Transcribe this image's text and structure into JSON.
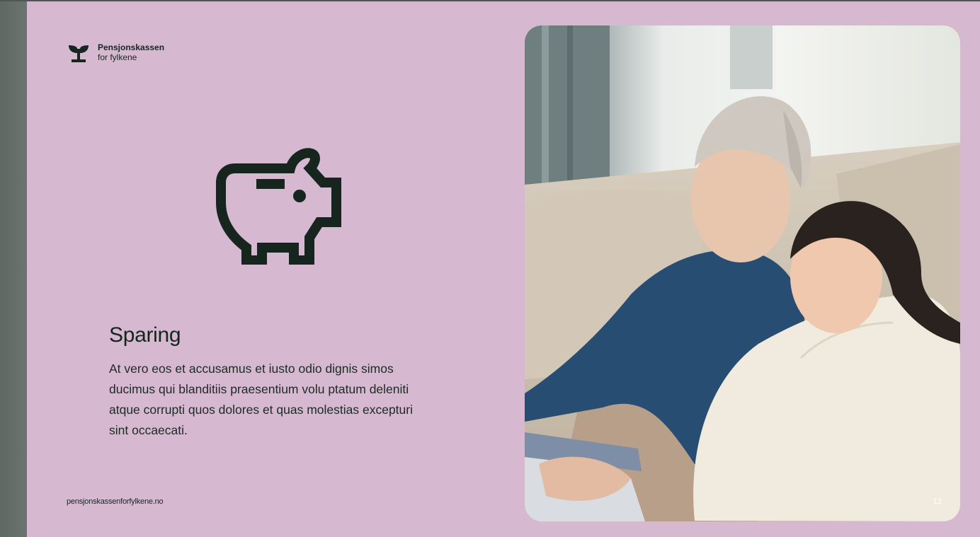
{
  "brand": {
    "name": "Pensjonskassen",
    "sub": "for fylkene",
    "logo_icon": "sprout-icon"
  },
  "icon": "piggy-bank-icon",
  "section": {
    "title": "Sparing",
    "body": "At vero eos et accusamus et iusto odio dignis simos ducimus qui blanditiis praesentium volu ptatum deleniti atque corrupti quos dolores et quas molestias excepturi sint occaecati."
  },
  "footer": {
    "url": "pensjonskassenforfylkene.no"
  },
  "page": {
    "number": "12"
  },
  "photo": {
    "subject": "two-women-laughing-photo"
  },
  "colors": {
    "slide_background": "#d6b9d0",
    "ink": "#16261f",
    "frame": "#636b67"
  }
}
